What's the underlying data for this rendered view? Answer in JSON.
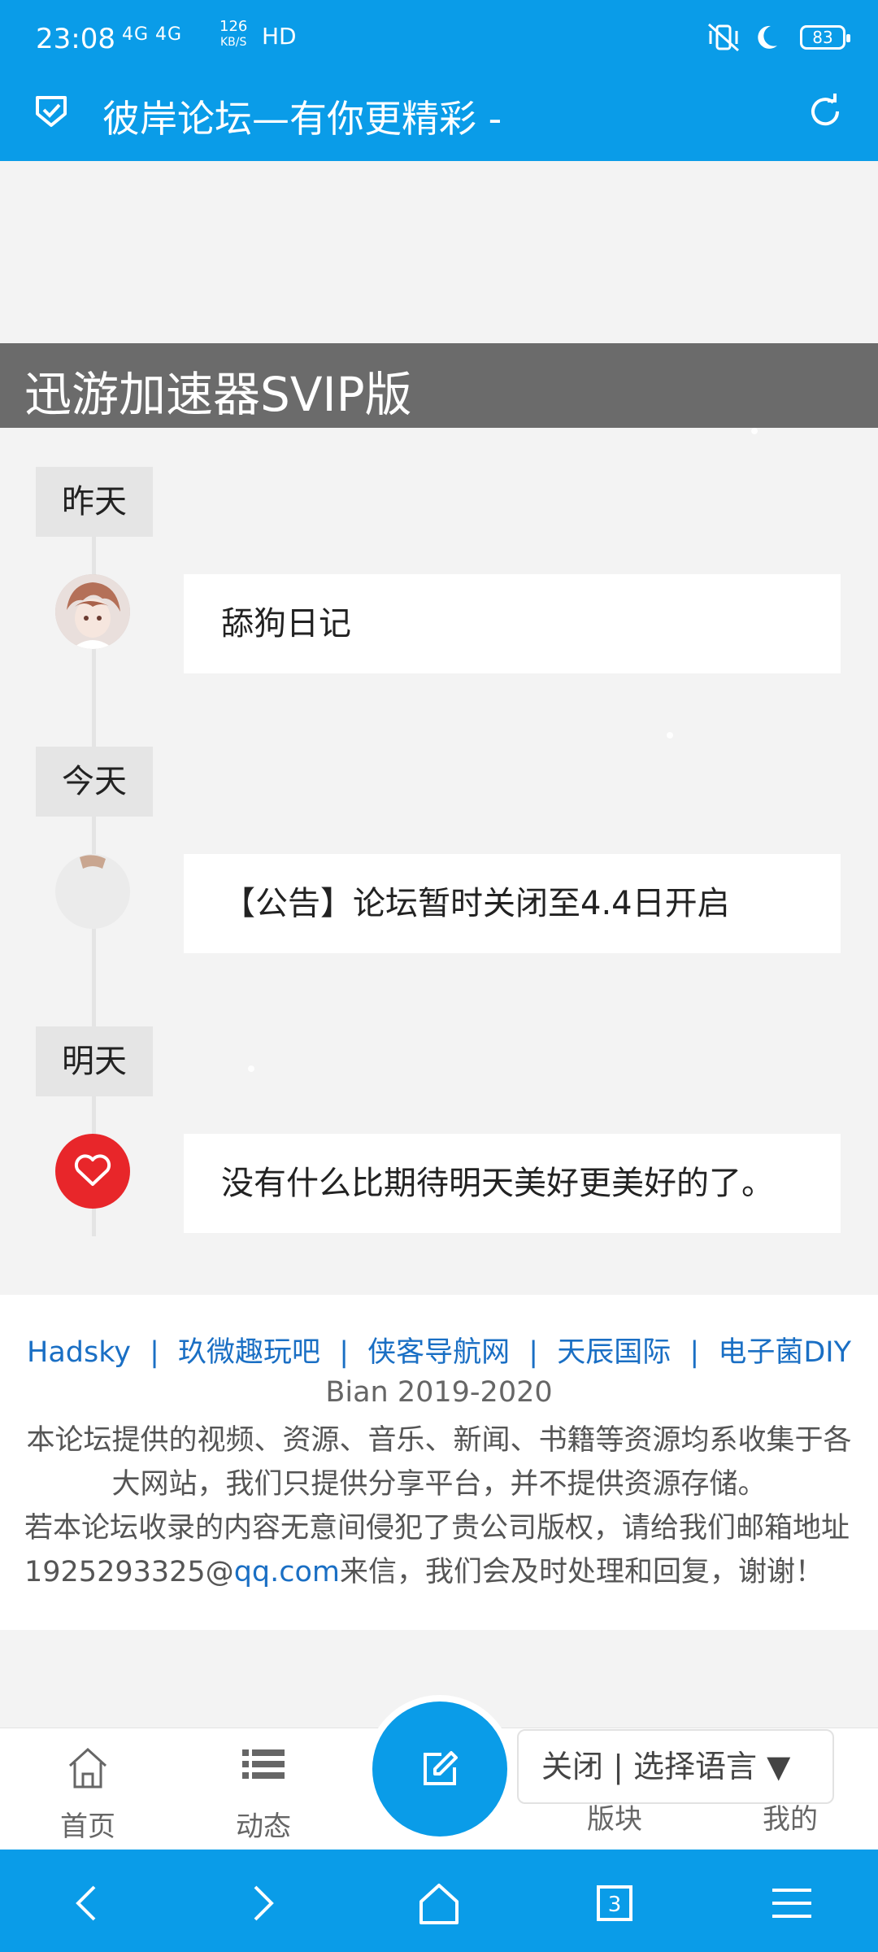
{
  "status_bar": {
    "time": "23:08",
    "network": "4G 4G",
    "speed_value": "126",
    "speed_unit": "KB/S",
    "hd": "HD",
    "battery": "83"
  },
  "header": {
    "title": "彼岸论坛—有你更精彩 -",
    "background": "#0a9ce8"
  },
  "banner": {
    "text": "迅游加速器SVIP版"
  },
  "timeline": [
    {
      "day": "昨天",
      "post": "舔狗日记",
      "avatar": "anime-avatar"
    },
    {
      "day": "今天",
      "post": "【公告】论坛暂时关闭至4.4日开启",
      "avatar": "partial-avatar"
    },
    {
      "day": "明天",
      "post": "没有什么比期待明天美好更美好的了。",
      "avatar": "heart-icon"
    }
  ],
  "footer": {
    "links": [
      "Hadsky",
      "玖微趣玩吧",
      "侠客导航网",
      "天辰国际",
      "电子菌DIY"
    ],
    "link_separator": "|",
    "copyright": "Bian 2019-2020",
    "notice_1": "本论坛提供的视频、资源、音乐、新闻、书籍等资源均系收集于各大网站，我们只提供分享平台，并不提供资源存储。",
    "notice_2_prefix": "若本论坛收录的内容无意间侵犯了贵公司版权，请给我们邮箱地址1925293325@",
    "notice_2_link": "qq.com",
    "notice_2_suffix": "来信，我们会及时处理和回复，谢谢！"
  },
  "bottom_nav": {
    "home": "首页",
    "feed": "动态",
    "boards": "版块",
    "mine": "我的"
  },
  "language_picker": {
    "close": "关闭",
    "separator": "|",
    "label": "选择语言",
    "arrow": "▼"
  }
}
